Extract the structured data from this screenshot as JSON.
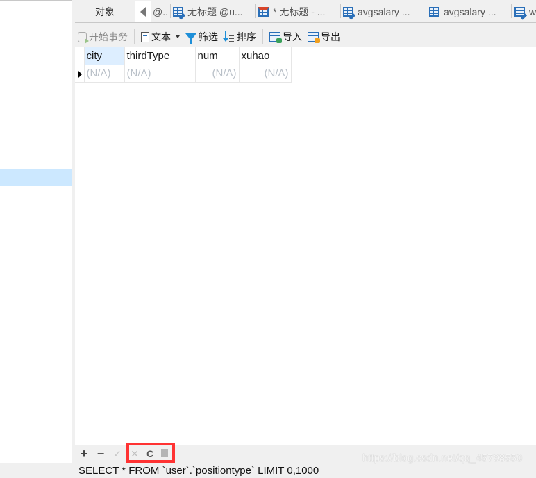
{
  "tabs": {
    "objects_label": "对象",
    "items": [
      {
        "label": "@...",
        "icon": "table-edit-icon"
      },
      {
        "label": "无标题 @u...",
        "icon": "table-edit-icon"
      },
      {
        "label": "* 无标题 - ...",
        "icon": "table-design-icon"
      },
      {
        "label": "avgsalary ...",
        "icon": "table-edit-icon"
      },
      {
        "label": "avgsalary ...",
        "icon": "table-icon"
      },
      {
        "label": "w",
        "icon": "table-edit-icon"
      }
    ]
  },
  "toolbar": {
    "begin_transaction": "开始事务",
    "text": "文本",
    "filter": "筛选",
    "sort": "排序",
    "import": "导入",
    "export": "导出"
  },
  "grid": {
    "columns": [
      "city",
      "thirdType",
      "num",
      "xuhao"
    ],
    "rows": [
      [
        "(N/A)",
        "(N/A)",
        "(N/A)",
        "(N/A)"
      ]
    ]
  },
  "navbar": {
    "add": "+",
    "delete": "−",
    "apply": "✓",
    "discard": "✕",
    "refresh": "C"
  },
  "status": {
    "sql": "SELECT * FROM `user`.`positiontype` LIMIT 0,1000",
    "watermark": "https://blog.csdn.net/qq_45798550"
  }
}
